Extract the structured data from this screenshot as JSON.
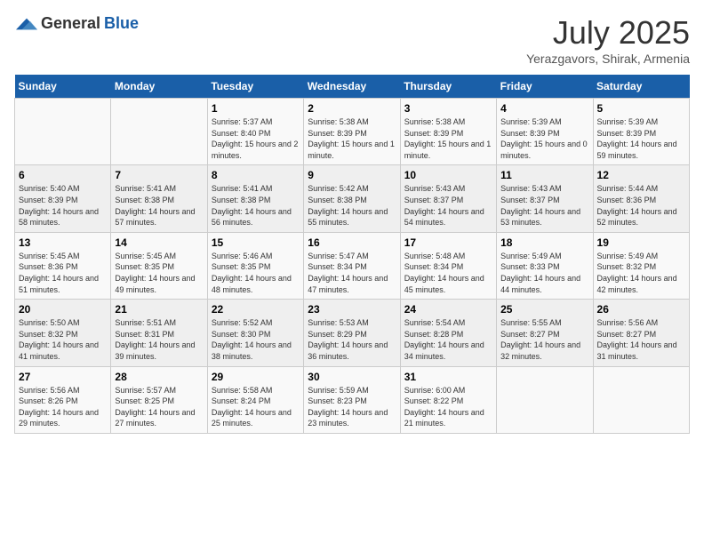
{
  "logo": {
    "general": "General",
    "blue": "Blue"
  },
  "title": "July 2025",
  "subtitle": "Yerazgavors, Shirak, Armenia",
  "weekdays": [
    "Sunday",
    "Monday",
    "Tuesday",
    "Wednesday",
    "Thursday",
    "Friday",
    "Saturday"
  ],
  "weeks": [
    [
      {
        "day": "",
        "sunrise": "",
        "sunset": "",
        "daylight": ""
      },
      {
        "day": "",
        "sunrise": "",
        "sunset": "",
        "daylight": ""
      },
      {
        "day": "1",
        "sunrise": "Sunrise: 5:37 AM",
        "sunset": "Sunset: 8:40 PM",
        "daylight": "Daylight: 15 hours and 2 minutes."
      },
      {
        "day": "2",
        "sunrise": "Sunrise: 5:38 AM",
        "sunset": "Sunset: 8:39 PM",
        "daylight": "Daylight: 15 hours and 1 minute."
      },
      {
        "day": "3",
        "sunrise": "Sunrise: 5:38 AM",
        "sunset": "Sunset: 8:39 PM",
        "daylight": "Daylight: 15 hours and 1 minute."
      },
      {
        "day": "4",
        "sunrise": "Sunrise: 5:39 AM",
        "sunset": "Sunset: 8:39 PM",
        "daylight": "Daylight: 15 hours and 0 minutes."
      },
      {
        "day": "5",
        "sunrise": "Sunrise: 5:39 AM",
        "sunset": "Sunset: 8:39 PM",
        "daylight": "Daylight: 14 hours and 59 minutes."
      }
    ],
    [
      {
        "day": "6",
        "sunrise": "Sunrise: 5:40 AM",
        "sunset": "Sunset: 8:39 PM",
        "daylight": "Daylight: 14 hours and 58 minutes."
      },
      {
        "day": "7",
        "sunrise": "Sunrise: 5:41 AM",
        "sunset": "Sunset: 8:38 PM",
        "daylight": "Daylight: 14 hours and 57 minutes."
      },
      {
        "day": "8",
        "sunrise": "Sunrise: 5:41 AM",
        "sunset": "Sunset: 8:38 PM",
        "daylight": "Daylight: 14 hours and 56 minutes."
      },
      {
        "day": "9",
        "sunrise": "Sunrise: 5:42 AM",
        "sunset": "Sunset: 8:38 PM",
        "daylight": "Daylight: 14 hours and 55 minutes."
      },
      {
        "day": "10",
        "sunrise": "Sunrise: 5:43 AM",
        "sunset": "Sunset: 8:37 PM",
        "daylight": "Daylight: 14 hours and 54 minutes."
      },
      {
        "day": "11",
        "sunrise": "Sunrise: 5:43 AM",
        "sunset": "Sunset: 8:37 PM",
        "daylight": "Daylight: 14 hours and 53 minutes."
      },
      {
        "day": "12",
        "sunrise": "Sunrise: 5:44 AM",
        "sunset": "Sunset: 8:36 PM",
        "daylight": "Daylight: 14 hours and 52 minutes."
      }
    ],
    [
      {
        "day": "13",
        "sunrise": "Sunrise: 5:45 AM",
        "sunset": "Sunset: 8:36 PM",
        "daylight": "Daylight: 14 hours and 51 minutes."
      },
      {
        "day": "14",
        "sunrise": "Sunrise: 5:45 AM",
        "sunset": "Sunset: 8:35 PM",
        "daylight": "Daylight: 14 hours and 49 minutes."
      },
      {
        "day": "15",
        "sunrise": "Sunrise: 5:46 AM",
        "sunset": "Sunset: 8:35 PM",
        "daylight": "Daylight: 14 hours and 48 minutes."
      },
      {
        "day": "16",
        "sunrise": "Sunrise: 5:47 AM",
        "sunset": "Sunset: 8:34 PM",
        "daylight": "Daylight: 14 hours and 47 minutes."
      },
      {
        "day": "17",
        "sunrise": "Sunrise: 5:48 AM",
        "sunset": "Sunset: 8:34 PM",
        "daylight": "Daylight: 14 hours and 45 minutes."
      },
      {
        "day": "18",
        "sunrise": "Sunrise: 5:49 AM",
        "sunset": "Sunset: 8:33 PM",
        "daylight": "Daylight: 14 hours and 44 minutes."
      },
      {
        "day": "19",
        "sunrise": "Sunrise: 5:49 AM",
        "sunset": "Sunset: 8:32 PM",
        "daylight": "Daylight: 14 hours and 42 minutes."
      }
    ],
    [
      {
        "day": "20",
        "sunrise": "Sunrise: 5:50 AM",
        "sunset": "Sunset: 8:32 PM",
        "daylight": "Daylight: 14 hours and 41 minutes."
      },
      {
        "day": "21",
        "sunrise": "Sunrise: 5:51 AM",
        "sunset": "Sunset: 8:31 PM",
        "daylight": "Daylight: 14 hours and 39 minutes."
      },
      {
        "day": "22",
        "sunrise": "Sunrise: 5:52 AM",
        "sunset": "Sunset: 8:30 PM",
        "daylight": "Daylight: 14 hours and 38 minutes."
      },
      {
        "day": "23",
        "sunrise": "Sunrise: 5:53 AM",
        "sunset": "Sunset: 8:29 PM",
        "daylight": "Daylight: 14 hours and 36 minutes."
      },
      {
        "day": "24",
        "sunrise": "Sunrise: 5:54 AM",
        "sunset": "Sunset: 8:28 PM",
        "daylight": "Daylight: 14 hours and 34 minutes."
      },
      {
        "day": "25",
        "sunrise": "Sunrise: 5:55 AM",
        "sunset": "Sunset: 8:27 PM",
        "daylight": "Daylight: 14 hours and 32 minutes."
      },
      {
        "day": "26",
        "sunrise": "Sunrise: 5:56 AM",
        "sunset": "Sunset: 8:27 PM",
        "daylight": "Daylight: 14 hours and 31 minutes."
      }
    ],
    [
      {
        "day": "27",
        "sunrise": "Sunrise: 5:56 AM",
        "sunset": "Sunset: 8:26 PM",
        "daylight": "Daylight: 14 hours and 29 minutes."
      },
      {
        "day": "28",
        "sunrise": "Sunrise: 5:57 AM",
        "sunset": "Sunset: 8:25 PM",
        "daylight": "Daylight: 14 hours and 27 minutes."
      },
      {
        "day": "29",
        "sunrise": "Sunrise: 5:58 AM",
        "sunset": "Sunset: 8:24 PM",
        "daylight": "Daylight: 14 hours and 25 minutes."
      },
      {
        "day": "30",
        "sunrise": "Sunrise: 5:59 AM",
        "sunset": "Sunset: 8:23 PM",
        "daylight": "Daylight: 14 hours and 23 minutes."
      },
      {
        "day": "31",
        "sunrise": "Sunrise: 6:00 AM",
        "sunset": "Sunset: 8:22 PM",
        "daylight": "Daylight: 14 hours and 21 minutes."
      },
      {
        "day": "",
        "sunrise": "",
        "sunset": "",
        "daylight": ""
      },
      {
        "day": "",
        "sunrise": "",
        "sunset": "",
        "daylight": ""
      }
    ]
  ]
}
